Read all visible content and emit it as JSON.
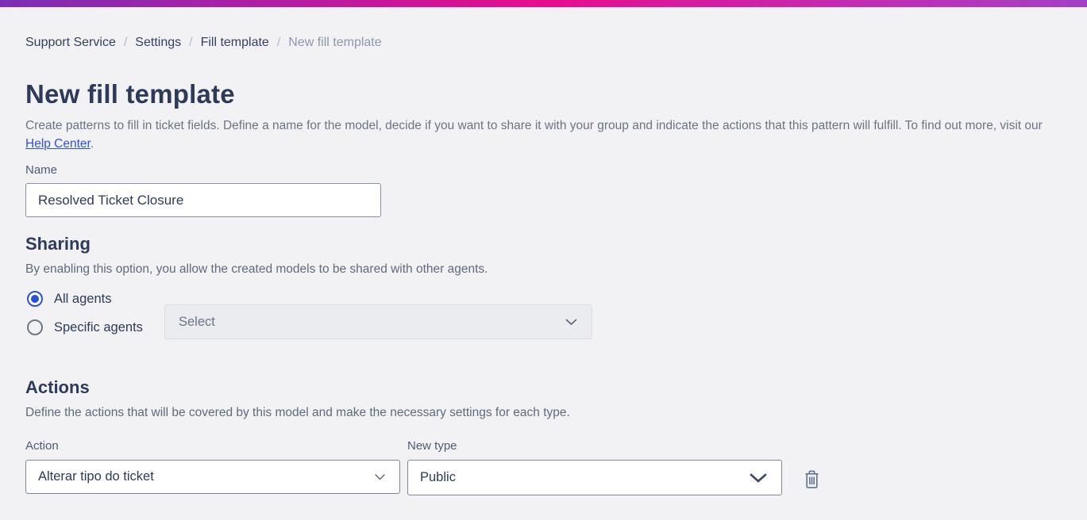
{
  "topbar": {
    "gradient_left": "#7b2eb4",
    "gradient_mid": "#e60d8d",
    "gradient_right": "#a440c6"
  },
  "breadcrumb": {
    "separator": "/",
    "items": [
      "Support Service",
      "Settings",
      "Fill template"
    ],
    "current": "New fill template"
  },
  "header": {
    "title": "New fill template",
    "description_before_link": "Create patterns to fill in ticket fields. Define a name for the model, decide if you want to share it with your group and indicate the actions that this pattern will fulfill. To find out more, visit our ",
    "link_text": "Help Center",
    "description_after_link": "."
  },
  "name_field": {
    "label": "Name",
    "value": "Resolved Ticket Closure"
  },
  "sharing": {
    "title": "Sharing",
    "description": "By enabling this option, you allow the created models to be shared with other agents.",
    "options": [
      {
        "label": "All agents",
        "selected": true
      },
      {
        "label": "Specific agents",
        "selected": false
      }
    ],
    "agents_select_placeholder": "Select"
  },
  "actions": {
    "title": "Actions",
    "description": "Define the actions that will be covered by this model and make the necessary settings for each type.",
    "row": {
      "action_label": "Action",
      "action_value": "Alterar tipo do ticket",
      "type_label": "New type",
      "type_value": "Public"
    }
  },
  "colors": {
    "radio_selected": "#2b4fd8",
    "link": "#2d53de",
    "heading": "#2e3a59",
    "page_background": "#f2f2f5"
  }
}
